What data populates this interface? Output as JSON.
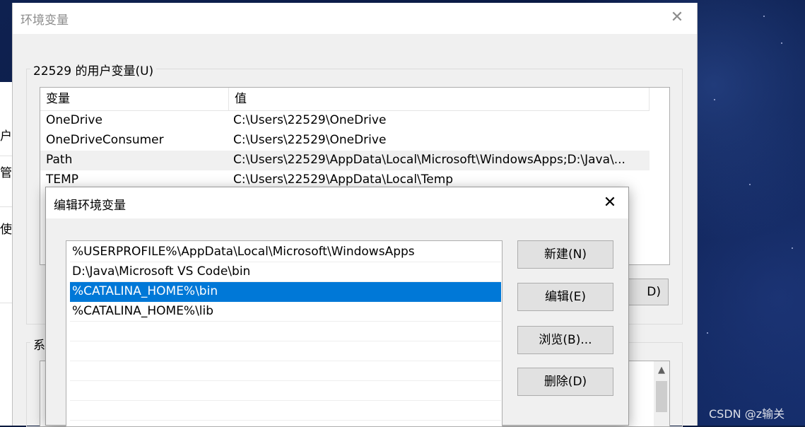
{
  "main_window": {
    "title": "环境变量",
    "close_glyph": "✕",
    "user_section_label": "22529 的用户变量(U)",
    "user_vars": {
      "columns": [
        "变量",
        "值"
      ],
      "rows": [
        {
          "name": "OneDrive",
          "value": "C:\\Users\\22529\\OneDrive"
        },
        {
          "name": "OneDriveConsumer",
          "value": "C:\\Users\\22529\\OneDrive"
        },
        {
          "name": "Path",
          "value": "C:\\Users\\22529\\AppData\\Local\\Microsoft\\WindowsApps;D:\\Java\\..."
        },
        {
          "name": "TEMP",
          "value": "C:\\Users\\22529\\AppData\\Local\\Temp"
        }
      ],
      "selected_index": 2
    },
    "user_delete_button_label": "D)",
    "system_section_label": "系",
    "scroll_up_glyph": "▲"
  },
  "background_window": {
    "fragments": [
      "户",
      "管",
      "使"
    ]
  },
  "edit_dialog": {
    "title": "编辑环境变量",
    "close_glyph": "✕",
    "paths": [
      "%USERPROFILE%\\AppData\\Local\\Microsoft\\WindowsApps",
      "D:\\Java\\Microsoft VS Code\\bin",
      "%CATALINA_HOME%\\bin",
      "%CATALINA_HOME%\\lib"
    ],
    "selected_index": 2,
    "buttons": {
      "new": "新建(N)",
      "edit": "编辑(E)",
      "browse": "浏览(B)...",
      "delete": "删除(D)"
    }
  },
  "watermark": "CSDN @z输关",
  "colors": {
    "selection": "#0078d7",
    "window_bg": "#f0f0f0",
    "desktop": "#0b1a3f"
  }
}
